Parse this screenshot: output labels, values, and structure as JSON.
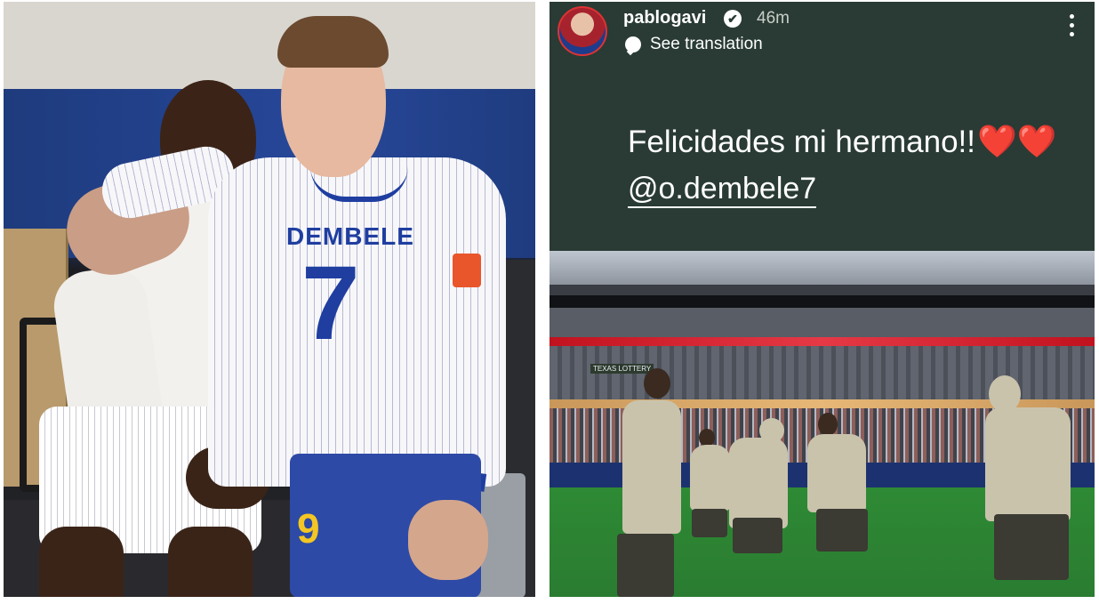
{
  "left_photo": {
    "jersey_name": "DEMBELE",
    "jersey_number": "7",
    "shorts_number": "9"
  },
  "story": {
    "username": "pablogavi",
    "verified": "✔",
    "time_ago": "46m",
    "see_translation": "See translation",
    "text": "Felicidades mi hermano!!",
    "hearts": "❤️❤️",
    "mention": "@o.dembele7"
  },
  "stadium_photo": {
    "screen_text": "TEXAS LOTTERY"
  }
}
